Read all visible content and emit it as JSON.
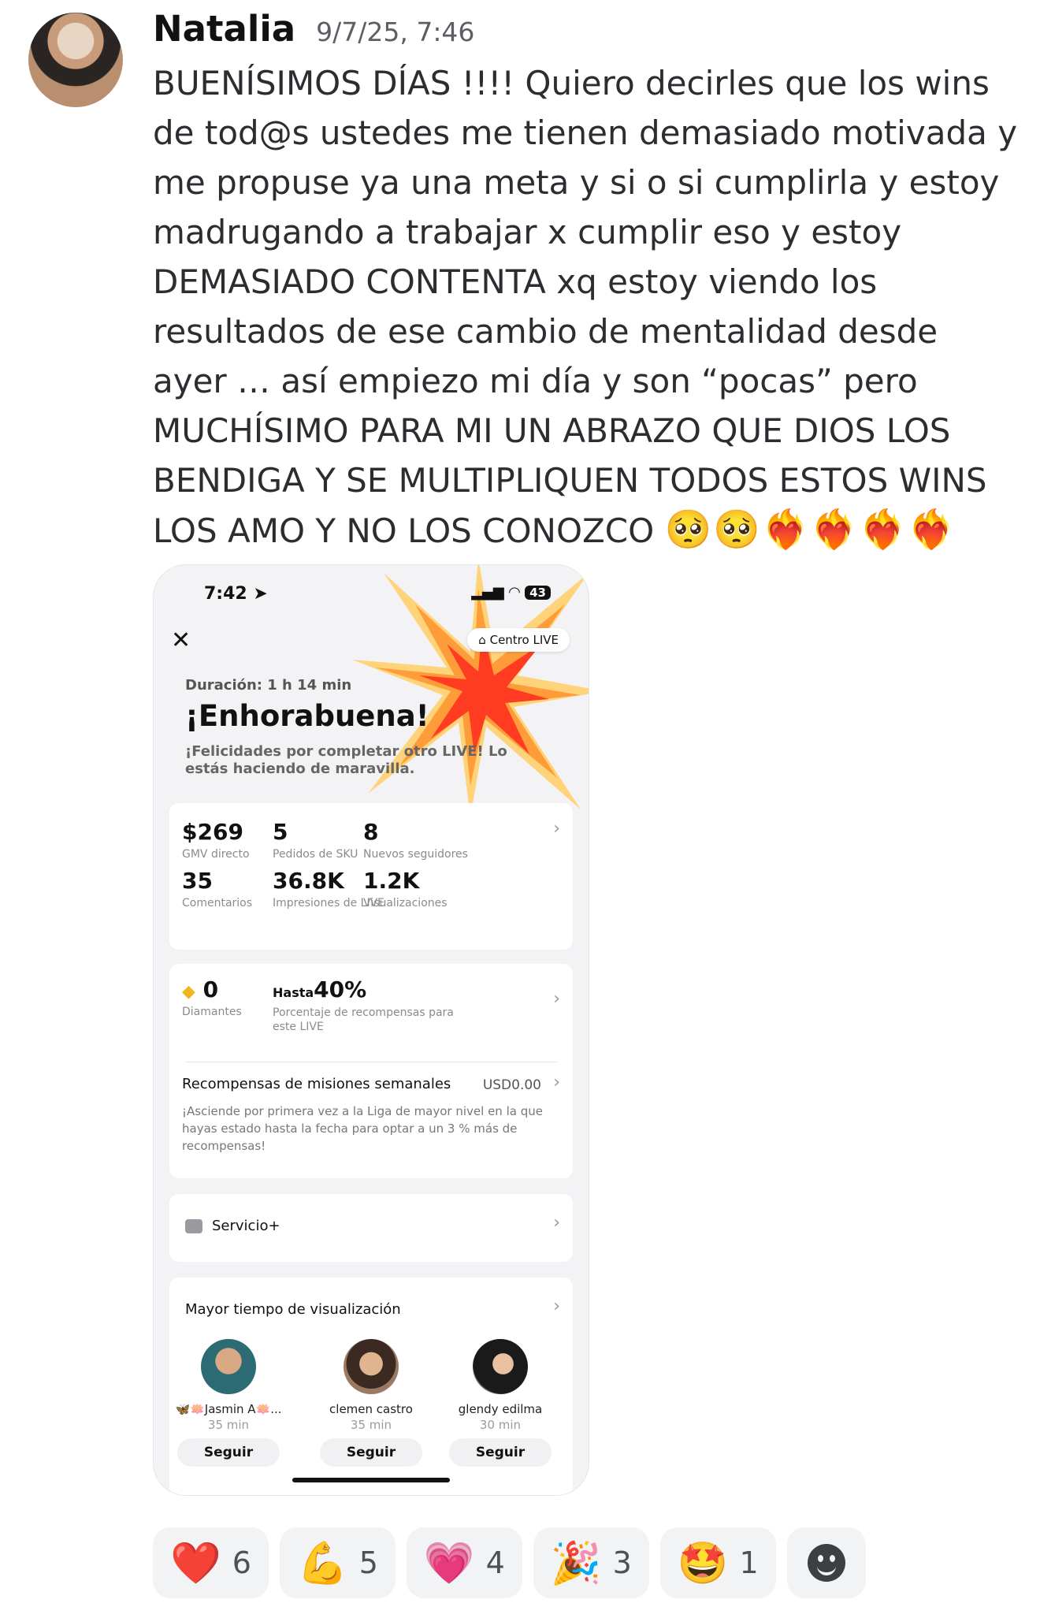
{
  "message": {
    "author": "Natalia",
    "timestamp": "9/7/25, 7:46",
    "text": "BUENÍSIMOS DÍAS !!!! Quiero decirles que los wins de tod@s ustedes me tienen demasiado motivada y me propuse ya una meta y si o si cumplirla y estoy madrugando a trabajar x cumplir eso y estoy DEMASIADO CONTENTA xq estoy viendo los resultados de ese cambio de mentalidad desde ayer … así empiezo mi día y son “pocas” pero MUCHÍSIMO PARA MI UN ABRAZO QUE DIOS LOS BENDIGA Y SE MULTIPLIQUEN TODOS ESTOS WINS LOS AMO Y NO LOS CONOZCO",
    "emojis": "🥺🥺❤️‍🔥❤️‍🔥❤️‍🔥❤️‍🔥"
  },
  "attachment": {
    "status_bar": {
      "time": "7:42",
      "battery": "43"
    },
    "centro_live_label": "Centro LIVE",
    "duration": "Duración: 1 h 14 min",
    "headline": "¡Enhorabuena!",
    "subtitle": "¡Felicidades por completar otro LIVE! Lo estás haciendo de maravilla.",
    "stats": [
      {
        "value": "$269",
        "label": "GMV directo"
      },
      {
        "value": "5",
        "label": "Pedidos de SKU"
      },
      {
        "value": "8",
        "label": "Nuevos seguidores"
      },
      {
        "value": "35",
        "label": "Comentarios"
      },
      {
        "value": "36.8K",
        "label": "Impresiones de LIVE"
      },
      {
        "value": "1.2K",
        "label": "Visualizaciones"
      }
    ],
    "diamonds": {
      "value": "0",
      "label": "Diamantes"
    },
    "rewards_pct": {
      "prefix": "Hasta",
      "value": "40%",
      "label": "Porcentaje de recompensas para este LIVE"
    },
    "weekly": {
      "title": "Recompensas de misiones semanales",
      "amount": "USD0.00",
      "description": "¡Asciende por primera vez a la Liga de mayor nivel en la que hayas estado hasta la fecha para optar a un 3 % más de recompensas!"
    },
    "servicio_label": "Servicio+",
    "viewers_title": "Mayor tiempo de visualización",
    "viewers": [
      {
        "name": "🦋🪷Jasmin A🪷...",
        "time": "35 min",
        "button": "Seguir"
      },
      {
        "name": "clemen castro",
        "time": "35 min",
        "button": "Seguir"
      },
      {
        "name": "glendy edilma",
        "time": "30 min",
        "button": "Seguir"
      }
    ]
  },
  "reactions": [
    {
      "emoji": "❤️",
      "count": "6"
    },
    {
      "emoji": "💪",
      "count": "5"
    },
    {
      "emoji": "💗",
      "count": "4"
    },
    {
      "emoji": "🎉",
      "count": "3"
    },
    {
      "emoji": "🤩",
      "count": "1"
    }
  ]
}
